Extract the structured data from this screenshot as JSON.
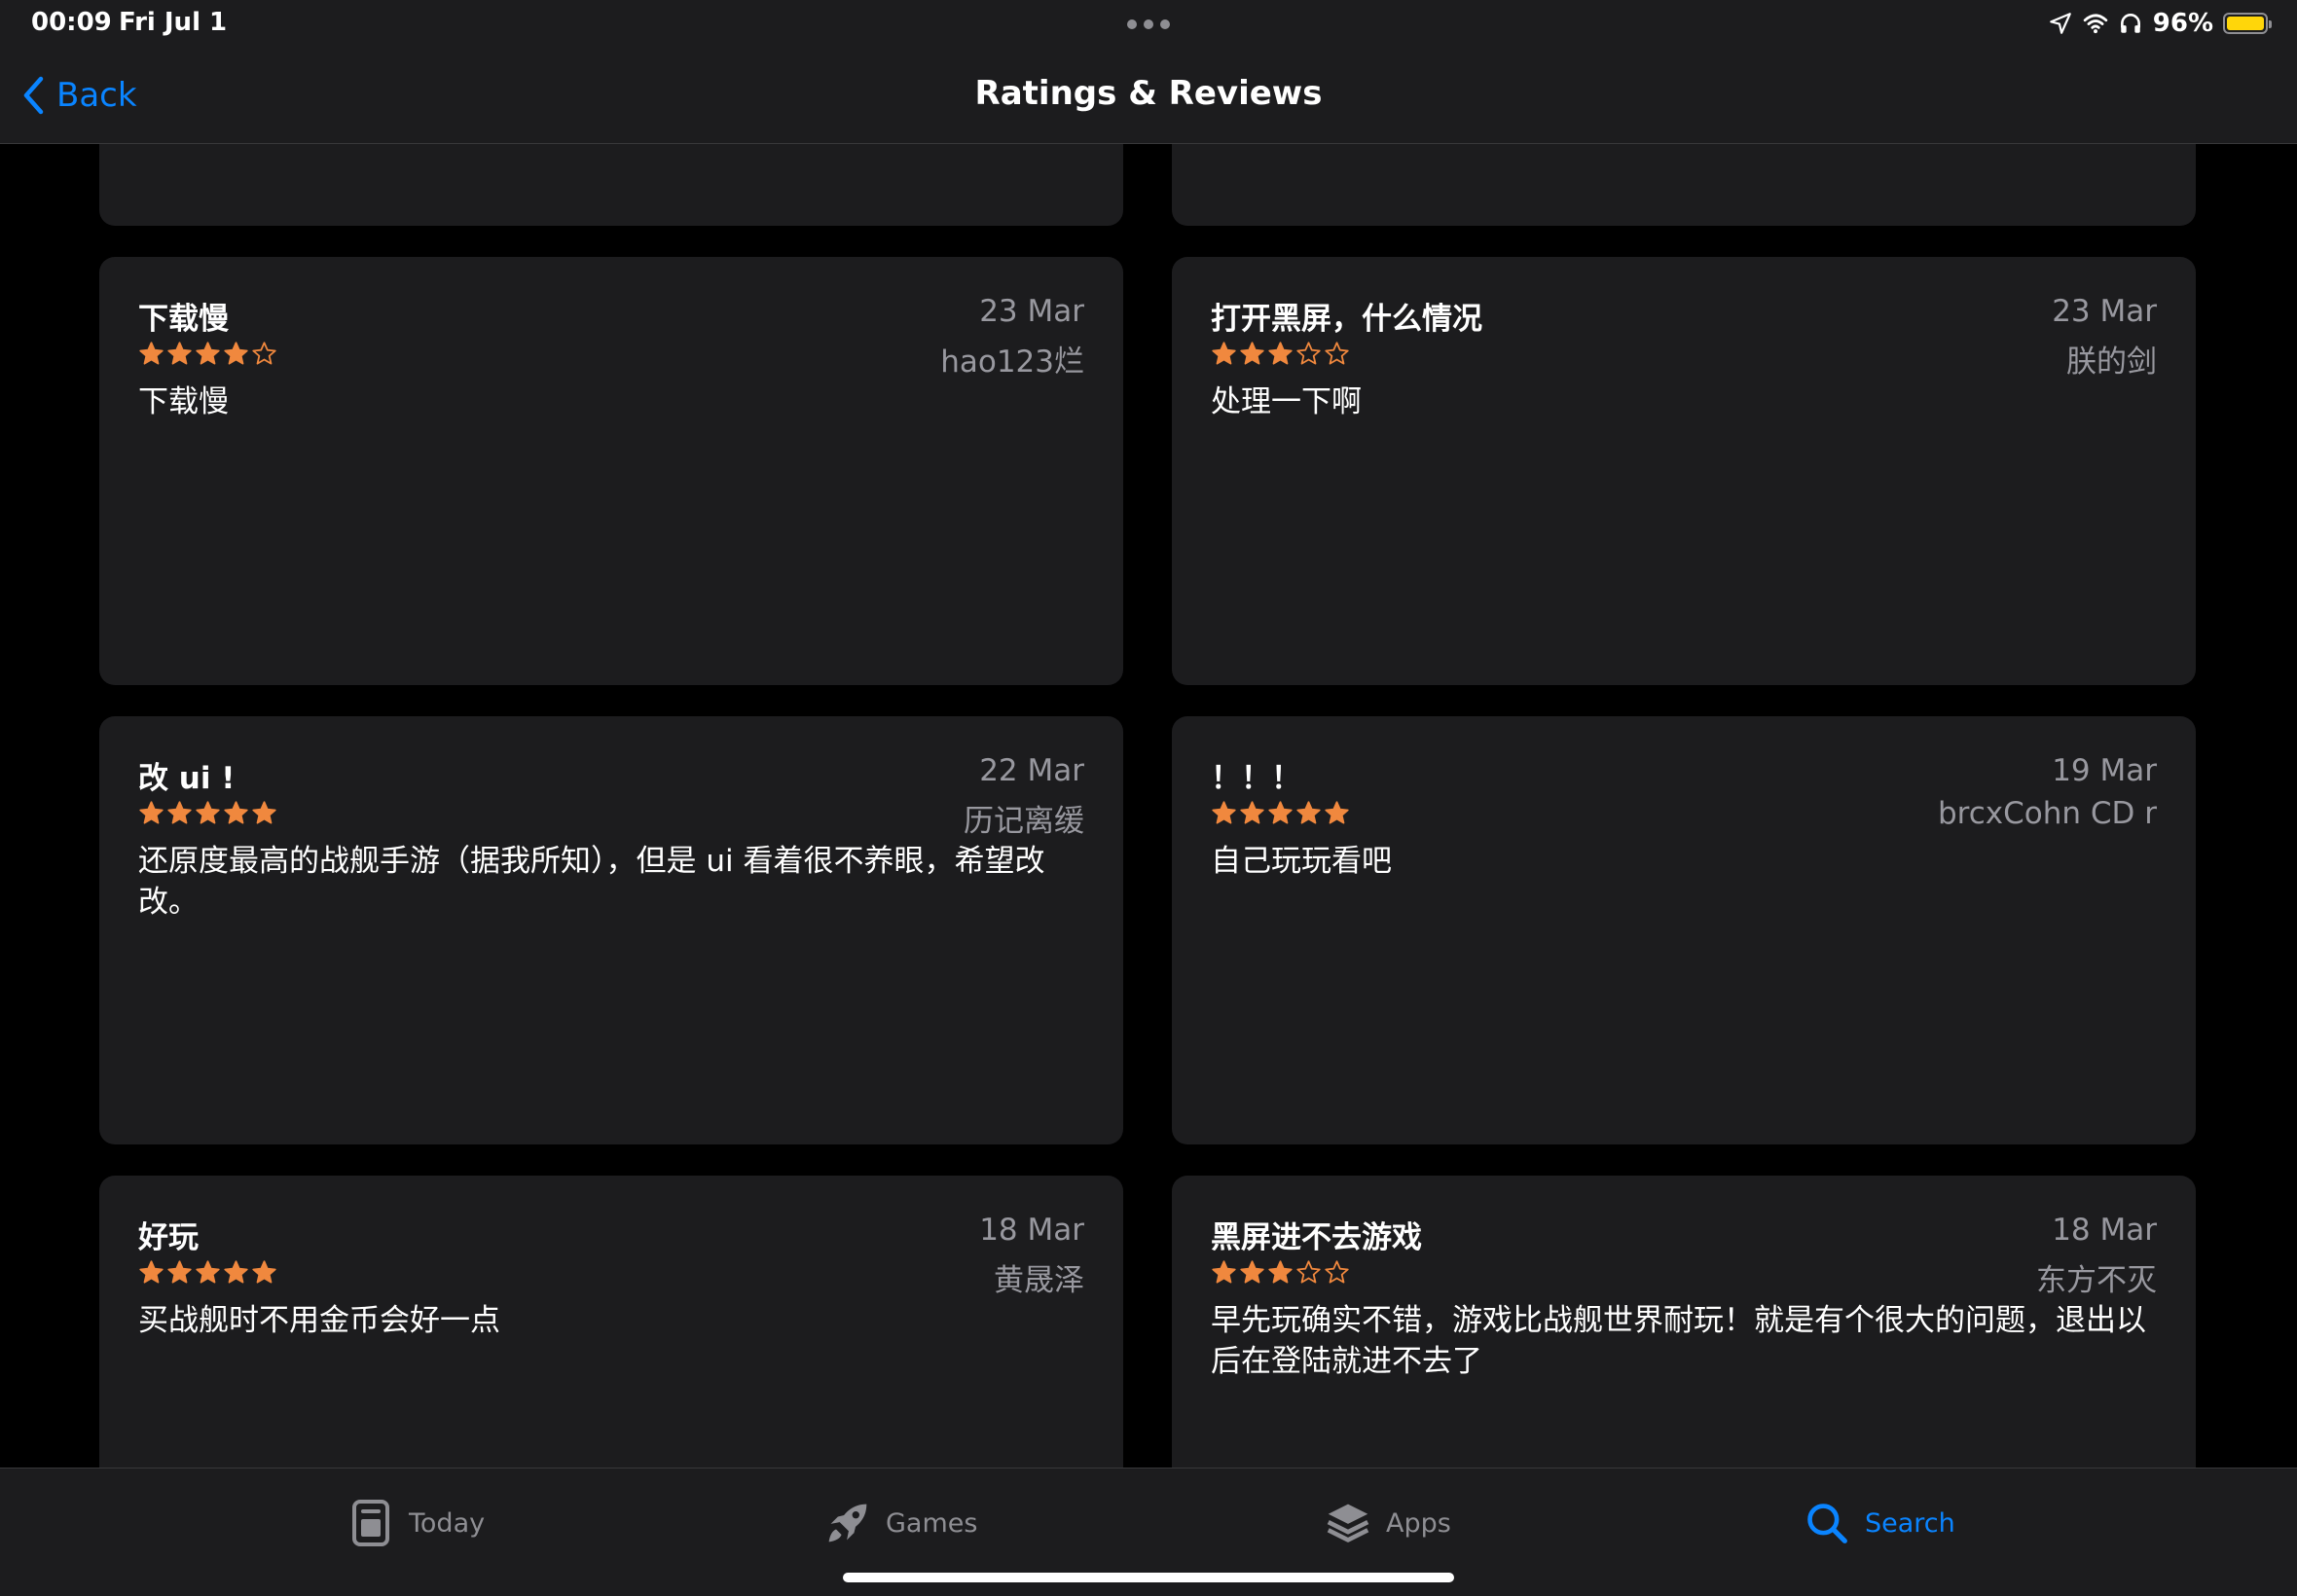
{
  "status_bar": {
    "time": "00:09",
    "date": "Fri Jul 1",
    "battery_percent": "96%",
    "icons": [
      "location-arrow-icon",
      "wifi-icon",
      "headphones-icon",
      "battery-icon"
    ],
    "battery_color": "#ffd60a"
  },
  "nav": {
    "back_label": "Back",
    "title": "Ratings & Reviews",
    "accent_color": "#0a84ff"
  },
  "reviews": [
    {
      "title": "下载慢",
      "date": "23 Mar",
      "author": "hao123烂",
      "rating": 4,
      "body": "下载慢"
    },
    {
      "title": "打开黑屏，什么情况",
      "date": "23 Mar",
      "author": "朕的剑",
      "rating": 3,
      "body": "处理一下啊"
    },
    {
      "title": "改 ui !",
      "date": "22 Mar",
      "author": "历记离缓",
      "rating": 5,
      "body": "还原度最高的战舰手游（据我所知），但是 ui 看着很不养眼，希望改改。"
    },
    {
      "title": "！！！",
      "date": "19 Mar",
      "author": "brcxCohn CD r",
      "rating": 5,
      "body": "自己玩玩看吧"
    },
    {
      "title": "好玩",
      "date": "18 Mar",
      "author": "黄晟泽",
      "rating": 5,
      "body": "买战舰时不用金币会好一点"
    },
    {
      "title": "黑屏进不去游戏",
      "date": "18 Mar",
      "author": "东方不灭",
      "rating": 3,
      "body": "早先玩确实不错，游戏比战舰世界耐玩！就是有个很大的问题，退出以后在登陆就进不去了"
    }
  ],
  "star_color": "#f0883e",
  "tabs": [
    {
      "label": "Today",
      "icon": "today-icon",
      "active": false
    },
    {
      "label": "Games",
      "icon": "rocket-icon",
      "active": false
    },
    {
      "label": "Apps",
      "icon": "layers-icon",
      "active": false
    },
    {
      "label": "Search",
      "icon": "search-icon",
      "active": true
    }
  ]
}
